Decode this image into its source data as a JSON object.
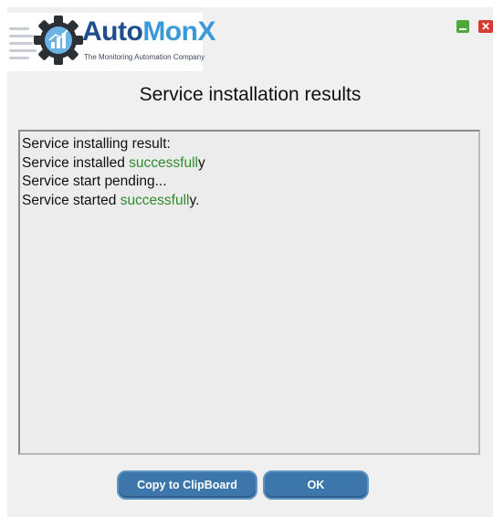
{
  "brand": {
    "name_part1": "Auto",
    "name_part2": "MonX",
    "tagline": "The Monitoring Automation Company",
    "accent": "#1e4f8c",
    "accent_light": "#3a9ad9"
  },
  "window_controls": {
    "close_glyph": "✕",
    "minimize_color": "#4ea83a",
    "close_color": "#d63b2f"
  },
  "dialog_title": "Service installation results",
  "results": [
    {
      "before": "Service installing result:",
      "highlight": "",
      "after": ""
    },
    {
      "before": "Service installed ",
      "highlight": "successfull",
      "after": "y"
    },
    {
      "before": "Service start pending...",
      "highlight": "",
      "after": ""
    },
    {
      "before": "Service started ",
      "highlight": "successfull",
      "after": "y."
    }
  ],
  "success_color": "#2e8b2e",
  "buttons": {
    "copy_label": "Copy to ClipBoard",
    "ok_label": "OK",
    "button_color": "#3c76aa"
  }
}
